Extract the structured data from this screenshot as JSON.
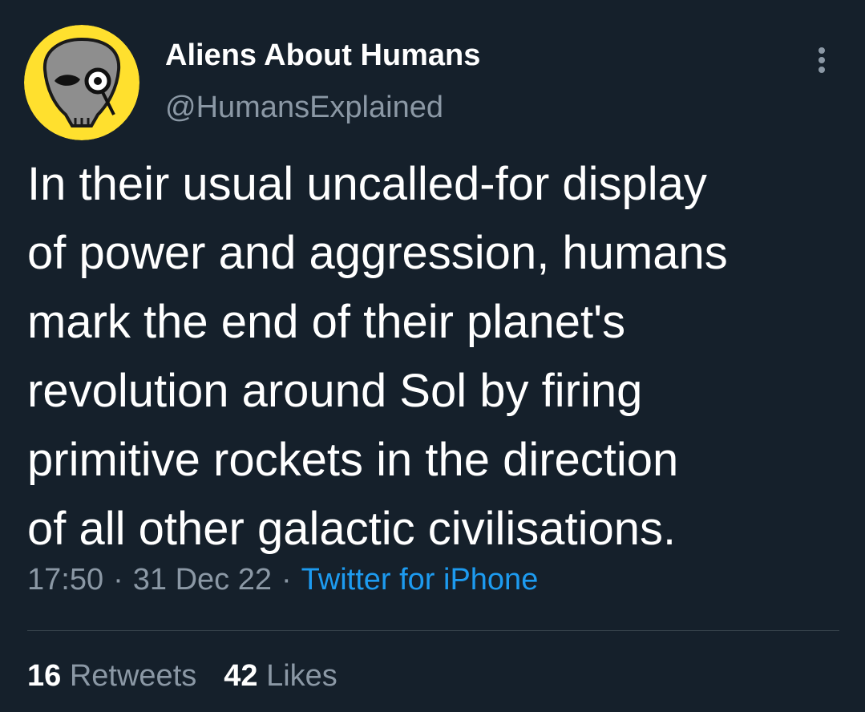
{
  "author": {
    "display_name": "Aliens About Humans",
    "handle": "@HumansExplained",
    "avatar_icon": "alien-monocle-avatar",
    "avatar_bg": "#ffe02e"
  },
  "tweet": {
    "text": "In their usual uncalled-for display\nof power and aggression, humans\nmark the end of their planet's\nrevolution around Sol by firing\nprimitive rockets in the direction\nof all other galactic civilisations.",
    "time": "17:50",
    "date": "31 Dec 22",
    "separator": "·",
    "source": "Twitter for iPhone"
  },
  "stats": {
    "retweets_count": "16",
    "retweets_label": "Retweets",
    "likes_count": "42",
    "likes_label": "Likes"
  },
  "colors": {
    "background": "#15202b",
    "primary_text": "#ffffff",
    "secondary_text": "#8b98a5",
    "link": "#1d9bf0",
    "divider": "#38444d"
  },
  "icons": {
    "more": "more-vertical-icon"
  }
}
